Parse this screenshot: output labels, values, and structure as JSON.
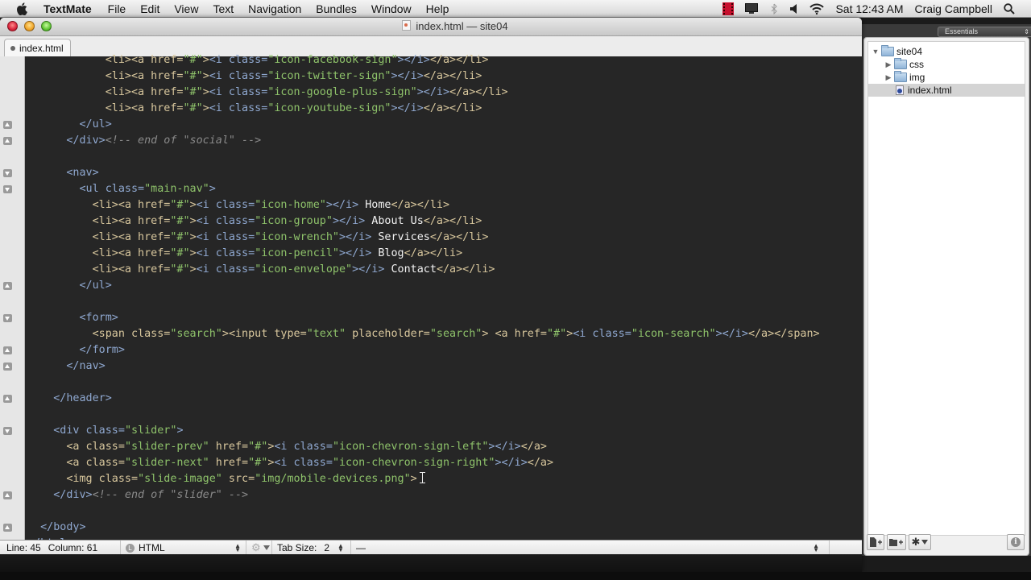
{
  "menubar": {
    "app_name": "TextMate",
    "items": [
      "File",
      "Edit",
      "View",
      "Text",
      "Navigation",
      "Bundles",
      "Window",
      "Help"
    ],
    "clock": "Sat 12:43 AM",
    "user": "Craig Campbell",
    "status_icons": [
      "screen-recorder-icon",
      "display-icon",
      "bluetooth-icon",
      "volume-icon",
      "wifi-icon"
    ]
  },
  "window": {
    "title": "index.html — site04",
    "tab_label": "index.html"
  },
  "editor": {
    "lines": [
      {
        "fold": "",
        "indent": 6,
        "tokens": [
          [
            "t",
            "<li><a href="
          ],
          [
            "s",
            "\"#\""
          ],
          [
            "t",
            ">"
          ],
          [
            "b",
            "<i class="
          ],
          [
            "s",
            "\"icon-facebook-sign\""
          ],
          [
            "b",
            "></i>"
          ],
          [
            "t",
            "</a></li>"
          ]
        ]
      },
      {
        "fold": "",
        "indent": 6,
        "tokens": [
          [
            "t",
            "<li><a href="
          ],
          [
            "s",
            "\"#\""
          ],
          [
            "t",
            ">"
          ],
          [
            "b",
            "<i class="
          ],
          [
            "s",
            "\"icon-twitter-sign\""
          ],
          [
            "b",
            "></i>"
          ],
          [
            "t",
            "</a></li>"
          ]
        ]
      },
      {
        "fold": "",
        "indent": 6,
        "tokens": [
          [
            "t",
            "<li><a href="
          ],
          [
            "s",
            "\"#\""
          ],
          [
            "t",
            ">"
          ],
          [
            "b",
            "<i class="
          ],
          [
            "s",
            "\"icon-google-plus-sign\""
          ],
          [
            "b",
            "></i>"
          ],
          [
            "t",
            "</a></li>"
          ]
        ]
      },
      {
        "fold": "",
        "indent": 6,
        "tokens": [
          [
            "t",
            "<li><a href="
          ],
          [
            "s",
            "\"#\""
          ],
          [
            "t",
            ">"
          ],
          [
            "b",
            "<i class="
          ],
          [
            "s",
            "\"icon-youtube-sign\""
          ],
          [
            "b",
            "></i>"
          ],
          [
            "t",
            "</a></li>"
          ]
        ]
      },
      {
        "fold": "up",
        "indent": 4,
        "tokens": [
          [
            "b",
            "</ul>"
          ]
        ]
      },
      {
        "fold": "up",
        "indent": 3,
        "tokens": [
          [
            "b",
            "</div>"
          ],
          [
            "c",
            "<!-- end of \"social\" -->"
          ]
        ]
      },
      {
        "fold": "",
        "indent": 0,
        "tokens": []
      },
      {
        "fold": "down",
        "indent": 3,
        "tokens": [
          [
            "b",
            "<nav>"
          ]
        ]
      },
      {
        "fold": "down",
        "indent": 4,
        "tokens": [
          [
            "b",
            "<ul class="
          ],
          [
            "s",
            "\"main-nav\""
          ],
          [
            "b",
            ">"
          ]
        ]
      },
      {
        "fold": "",
        "indent": 5,
        "tokens": [
          [
            "t",
            "<li><a href="
          ],
          [
            "s",
            "\"#\""
          ],
          [
            "t",
            ">"
          ],
          [
            "b",
            "<i class="
          ],
          [
            "s",
            "\"icon-home\""
          ],
          [
            "b",
            "></i>"
          ],
          [
            "w",
            " Home"
          ],
          [
            "t",
            "</a></li>"
          ]
        ]
      },
      {
        "fold": "",
        "indent": 5,
        "tokens": [
          [
            "t",
            "<li><a href="
          ],
          [
            "s",
            "\"#\""
          ],
          [
            "t",
            ">"
          ],
          [
            "b",
            "<i class="
          ],
          [
            "s",
            "\"icon-group\""
          ],
          [
            "b",
            "></i>"
          ],
          [
            "w",
            " About Us"
          ],
          [
            "t",
            "</a></li>"
          ]
        ]
      },
      {
        "fold": "",
        "indent": 5,
        "tokens": [
          [
            "t",
            "<li><a href="
          ],
          [
            "s",
            "\"#\""
          ],
          [
            "t",
            ">"
          ],
          [
            "b",
            "<i class="
          ],
          [
            "s",
            "\"icon-wrench\""
          ],
          [
            "b",
            "></i>"
          ],
          [
            "w",
            " Services"
          ],
          [
            "t",
            "</a></li>"
          ]
        ]
      },
      {
        "fold": "",
        "indent": 5,
        "tokens": [
          [
            "t",
            "<li><a href="
          ],
          [
            "s",
            "\"#\""
          ],
          [
            "t",
            ">"
          ],
          [
            "b",
            "<i class="
          ],
          [
            "s",
            "\"icon-pencil\""
          ],
          [
            "b",
            "></i>"
          ],
          [
            "w",
            " Blog"
          ],
          [
            "t",
            "</a></li>"
          ]
        ]
      },
      {
        "fold": "",
        "indent": 5,
        "tokens": [
          [
            "t",
            "<li><a href="
          ],
          [
            "s",
            "\"#\""
          ],
          [
            "t",
            ">"
          ],
          [
            "b",
            "<i class="
          ],
          [
            "s",
            "\"icon-envelope\""
          ],
          [
            "b",
            "></i>"
          ],
          [
            "w",
            " Contact"
          ],
          [
            "t",
            "</a></li>"
          ]
        ]
      },
      {
        "fold": "up",
        "indent": 4,
        "tokens": [
          [
            "b",
            "</ul>"
          ]
        ]
      },
      {
        "fold": "",
        "indent": 0,
        "tokens": []
      },
      {
        "fold": "down",
        "indent": 4,
        "tokens": [
          [
            "b",
            "<form>"
          ]
        ]
      },
      {
        "fold": "",
        "indent": 5,
        "tokens": [
          [
            "t",
            "<span class="
          ],
          [
            "s",
            "\"search\""
          ],
          [
            "t",
            ">"
          ],
          [
            "t",
            "<input type="
          ],
          [
            "s",
            "\"text\""
          ],
          [
            "t",
            " placeholder="
          ],
          [
            "s",
            "\"search\""
          ],
          [
            "t",
            "> <a href="
          ],
          [
            "s",
            "\"#\""
          ],
          [
            "t",
            ">"
          ],
          [
            "b",
            "<i class="
          ],
          [
            "s",
            "\"icon-search\""
          ],
          [
            "b",
            "></i>"
          ],
          [
            "t",
            "</a></span>"
          ]
        ]
      },
      {
        "fold": "up",
        "indent": 4,
        "tokens": [
          [
            "b",
            "</form>"
          ]
        ]
      },
      {
        "fold": "up",
        "indent": 3,
        "tokens": [
          [
            "b",
            "</nav>"
          ]
        ]
      },
      {
        "fold": "",
        "indent": 0,
        "tokens": []
      },
      {
        "fold": "up",
        "indent": 2,
        "tokens": [
          [
            "b",
            "</header>"
          ]
        ]
      },
      {
        "fold": "",
        "indent": 0,
        "tokens": []
      },
      {
        "fold": "down",
        "indent": 2,
        "tokens": [
          [
            "b",
            "<div class="
          ],
          [
            "s",
            "\"slider\""
          ],
          [
            "b",
            ">"
          ]
        ]
      },
      {
        "fold": "",
        "indent": 3,
        "tokens": [
          [
            "t",
            "<a class="
          ],
          [
            "s",
            "\"slider-prev\""
          ],
          [
            "t",
            " href="
          ],
          [
            "s",
            "\"#\""
          ],
          [
            "t",
            ">"
          ],
          [
            "b",
            "<i class="
          ],
          [
            "s",
            "\"icon-chevron-sign-left\""
          ],
          [
            "b",
            "></i>"
          ],
          [
            "t",
            "</a>"
          ]
        ]
      },
      {
        "fold": "",
        "indent": 3,
        "tokens": [
          [
            "t",
            "<a class="
          ],
          [
            "s",
            "\"slider-next\""
          ],
          [
            "t",
            " href="
          ],
          [
            "s",
            "\"#\""
          ],
          [
            "t",
            ">"
          ],
          [
            "b",
            "<i class="
          ],
          [
            "s",
            "\"icon-chevron-sign-right\""
          ],
          [
            "b",
            "></i>"
          ],
          [
            "t",
            "</a>"
          ]
        ]
      },
      {
        "fold": "",
        "indent": 3,
        "tokens": [
          [
            "t",
            "<img class="
          ],
          [
            "s",
            "\"slide-image\""
          ],
          [
            "t",
            " src="
          ],
          [
            "s",
            "\"img/mobile-devices.png\""
          ],
          [
            "t",
            ">"
          ]
        ],
        "cursor": true
      },
      {
        "fold": "up",
        "indent": 2,
        "tokens": [
          [
            "b",
            "</div>"
          ],
          [
            "c",
            "<!-- end of \"slider\" -->"
          ]
        ]
      },
      {
        "fold": "",
        "indent": 0,
        "tokens": []
      },
      {
        "fold": "up",
        "indent": 1,
        "tokens": [
          [
            "b",
            "</body>"
          ]
        ]
      },
      {
        "fold": "",
        "indent": 0,
        "tokens": [
          [
            "b",
            "</html>"
          ]
        ]
      }
    ]
  },
  "statusbar": {
    "line_label": "Line:",
    "line_value": "45",
    "column_label": "Column:",
    "column_value": "61",
    "language": "HTML",
    "tab_size_label": "Tab Size:",
    "tab_size_value": "2",
    "symbol": "—"
  },
  "drawer": {
    "workspace_select": "Essentials",
    "tree": [
      {
        "label": "site04",
        "type": "folder",
        "expanded": true,
        "depth": 0
      },
      {
        "label": "css",
        "type": "folder",
        "expanded": false,
        "depth": 1
      },
      {
        "label": "img",
        "type": "folder",
        "expanded": false,
        "depth": 1
      },
      {
        "label": "index.html",
        "type": "file",
        "depth": 1,
        "selected": true
      }
    ]
  }
}
